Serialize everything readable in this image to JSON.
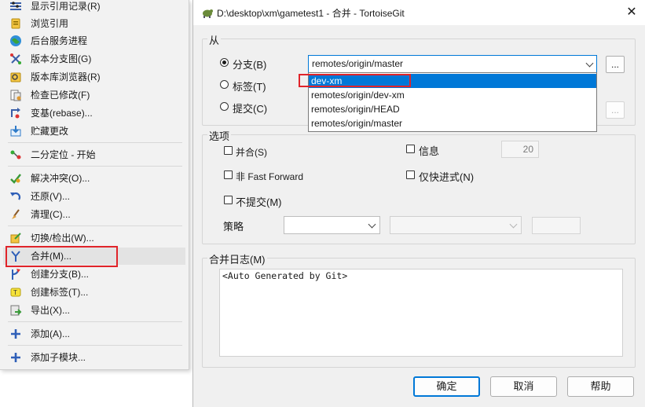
{
  "context_menu": {
    "items": [
      {
        "label": "显示引用记录(R)",
        "icon": "reflog-icon"
      },
      {
        "label": "浏览引用",
        "icon": "browse-refs-icon"
      },
      {
        "label": "后台服务进程",
        "icon": "daemon-icon"
      },
      {
        "label": "版本分支图(G)",
        "icon": "revision-graph-icon"
      },
      {
        "label": "版本库浏览器(R)",
        "icon": "repo-browser-icon"
      },
      {
        "label": "检查已修改(F)",
        "icon": "check-modifications-icon"
      },
      {
        "label": "变基(rebase)...",
        "icon": "rebase-icon"
      },
      {
        "label": "贮藏更改",
        "icon": "stash-icon"
      },
      {
        "label": "二分定位 - 开始",
        "icon": "bisect-icon"
      },
      {
        "label": "解决冲突(O)...",
        "icon": "resolve-icon"
      },
      {
        "label": "还原(V)...",
        "icon": "revert-icon"
      },
      {
        "label": "清理(C)...",
        "icon": "cleanup-icon"
      },
      {
        "label": "切换/检出(W)...",
        "icon": "switch-icon"
      },
      {
        "label": "合并(M)...",
        "icon": "merge-icon"
      },
      {
        "label": "创建分支(B)...",
        "icon": "branch-icon"
      },
      {
        "label": "创建标签(T)...",
        "icon": "tag-icon"
      },
      {
        "label": "导出(X)...",
        "icon": "export-icon"
      },
      {
        "label": "添加(A)...",
        "icon": "add-icon"
      },
      {
        "label": "添加子模块...",
        "icon": "add-submodule-icon"
      }
    ]
  },
  "dialog": {
    "title": "D:\\desktop\\xm\\gametest1 - 合并 - TortoiseGit",
    "close_glyph": "✕",
    "from": {
      "group_label": "从",
      "branch_label": "分支(B)",
      "tag_label": "标签(T)",
      "commit_label": "提交(C)",
      "branch_value": "remotes/origin/master",
      "browse_label": "...",
      "dropdown_options": [
        "dev-xm",
        "remotes/origin/dev-xm",
        "remotes/origin/HEAD",
        "remotes/origin/master"
      ],
      "selected_index": 0
    },
    "options": {
      "group_label": "选项",
      "squash_label": "并合(S)",
      "message_label": "信息",
      "log_count": "20",
      "no_ff_label": "非 Fast Forward",
      "ff_only_label": "仅快进式(N)",
      "no_commit_label": "不提交(M)",
      "strategy_label": "策略"
    },
    "merge_log": {
      "group_label": "合并日志(M)",
      "text": "<Auto Generated by Git>"
    },
    "buttons": {
      "ok": "确定",
      "cancel": "取消",
      "help": "帮助"
    }
  },
  "colors": {
    "accent": "#0078d7",
    "highlight_box": "#e0242a"
  }
}
